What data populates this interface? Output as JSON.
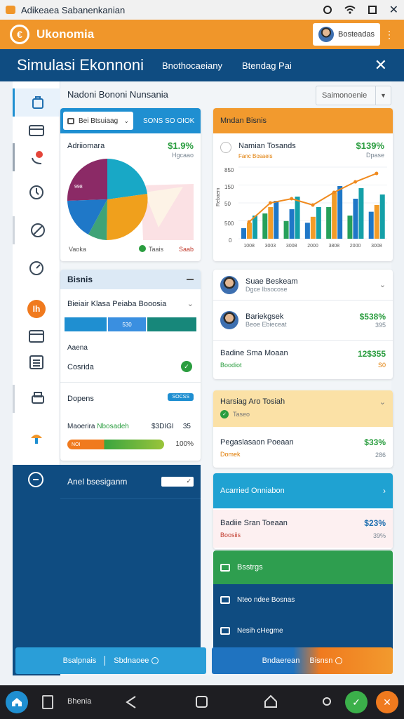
{
  "status_bar": {
    "title": "Adikeaea Sabanenkanian"
  },
  "app_bar": {
    "brand": "Ukonomia",
    "user_label": "Bosteadas"
  },
  "title_bar": {
    "title": "Simulasi Ekonnoni",
    "tabs": [
      "Bnothocaeiany",
      "Btendag Pai"
    ]
  },
  "top_bar": {
    "page_title": "Nadoni Bononi Nunsania",
    "select_value": "Saimonoenie"
  },
  "left_panel": {
    "dropdown_value": "Bei Btsuiaag",
    "tab_label": "SONS SO OIOK",
    "chart_title": "Adriiomara",
    "chart_value": "$1.9%",
    "chart_subvalue": "Hgcaao",
    "pie_label": "998",
    "legend_left": "Vaoka",
    "legend_mid": "Taais",
    "legend_right": "Saab"
  },
  "bisnis_card": {
    "title": "Bisnis",
    "row_title": "Bieiair Klasa Peiaba Booosia",
    "bar_label": "530",
    "label_a": "Aaena",
    "label_b": "Cosrida",
    "label_c": "Dopens",
    "tag": "SOCSS",
    "progress_label": "Maoerira",
    "progress_label2": "Nbosadeh",
    "progress_value": "$3DIGI",
    "progress_count": "35",
    "progress_inner": "NOI",
    "progress_percent": "100%"
  },
  "chart_card": {
    "title": "Mndan Bisnis",
    "subtitle": "Namian Tosands",
    "subtitle_small": "Fanc Bosaeis",
    "value": "$139%",
    "sub_value": "Dpase",
    "y_labels": [
      "850",
      "150",
      "50",
      "500",
      "0"
    ],
    "y_axis": "Rebaem",
    "x_labels": [
      "1008",
      "3003",
      "3008",
      "2000",
      "3808",
      "2000",
      "3008"
    ]
  },
  "chart_data": {
    "type": "bar",
    "categories": [
      "1008",
      "3003",
      "3008",
      "2000",
      "3808",
      "2000",
      "3008"
    ],
    "series": [
      {
        "values": [
          25,
          60,
          42,
          38,
          75,
          55,
          64
        ]
      },
      {
        "values": [
          38,
          75,
          70,
          52,
          110,
          95,
          80
        ]
      },
      {
        "values": [
          55,
          90,
          100,
          75,
          125,
          120,
          105
        ]
      }
    ],
    "line": [
      40,
      85,
      95,
      80,
      110,
      135,
      155
    ],
    "ylim": [
      0,
      170
    ],
    "colors": [
      "#1f77c7",
      "#f39c28",
      "#26a05a",
      "#14a0a8"
    ]
  },
  "list_card": {
    "item1_title": "Suae Beskeam",
    "item1_sub": "Dgce Ibsocose",
    "item2_title": "Bariekgsek",
    "item2_sub": "Beoe Ebieceat",
    "item2_value": "$538%",
    "item2_small": "395",
    "item3_title": "Badine Sma Moaan",
    "item3_sub": "Boodiot",
    "item3_value": "12$355",
    "item3_small": "S0"
  },
  "yellow_card": {
    "title": "Harsiag Aro Tosiah",
    "sub": "Taseo",
    "row_title": "Pegaslasaon Poeaan",
    "row_sub": "Domek",
    "row_value": "$33%",
    "row_small": "286"
  },
  "teal_card": {
    "title": "Acarried Onniabon",
    "row_title": "Badiie Sran Toeaan",
    "row_sub": "Boosiis",
    "row_value": "$23%",
    "row_small": "39%"
  },
  "green_card": {
    "label": "Bsstrgs"
  },
  "blue_card": {
    "item1": "Nteo ndee Bosnas",
    "item2": "Nesih cHegme"
  },
  "dark_panel": {
    "label": "Anel bsesiganm"
  },
  "bottom_bar": {
    "left_a": "Bsalpnais",
    "left_b": "Sbdnaoee",
    "right_a": "Bndaerean",
    "right_b": "Bisnsn"
  },
  "nav_bar": {
    "label": "Bhenia"
  }
}
